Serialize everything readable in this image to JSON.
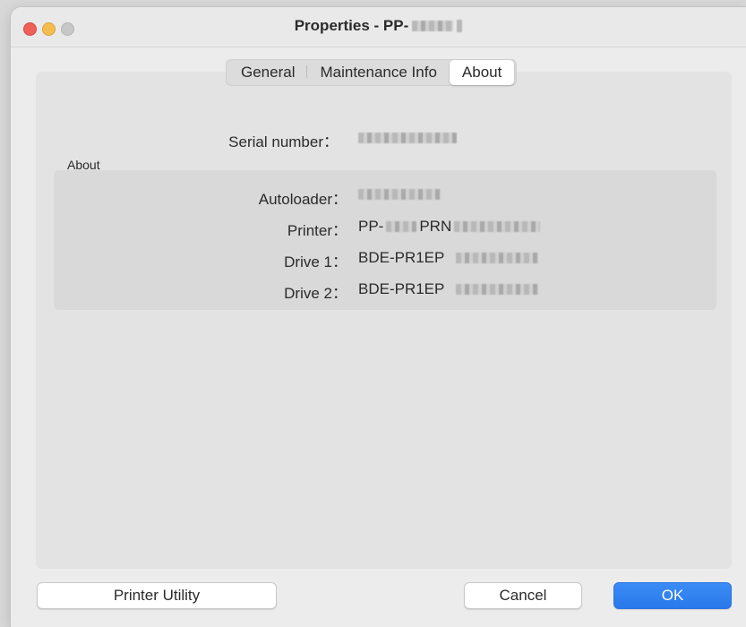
{
  "window": {
    "title_prefix": "Properties - PP-",
    "title_redacted": true
  },
  "tabs": [
    {
      "label": "General",
      "active": false
    },
    {
      "label": "Maintenance Info",
      "active": false
    },
    {
      "label": "About",
      "active": true
    }
  ],
  "serial": {
    "label": "Serial number：",
    "value_redacted": true
  },
  "about": {
    "section_label": "About",
    "rows": [
      {
        "label": "Autoloader：",
        "value": ""
      },
      {
        "label": "Printer：",
        "value": "PP-",
        "value_mid": "PRN"
      },
      {
        "label": "Drive 1：",
        "value": "BDE-PR1EP"
      },
      {
        "label": "Drive 2：",
        "value": "BDE-PR1EP"
      }
    ]
  },
  "buttons": {
    "printer_utility": "Printer Utility",
    "cancel": "Cancel",
    "ok": "OK"
  },
  "colors": {
    "accent": "#2a78ea",
    "close": "#ee5f57",
    "minimize": "#f5bd4f",
    "zoom_disabled": "#c7c7c7"
  }
}
